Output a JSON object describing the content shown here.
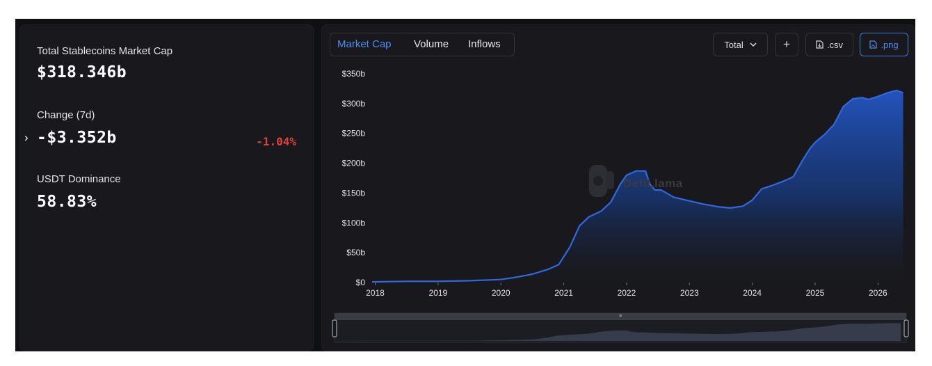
{
  "stats": {
    "market_cap_label": "Total Stablecoins Market Cap",
    "market_cap_value": "$318.346b",
    "change_label": "Change (7d)",
    "change_value": "-$3.352b",
    "change_pct": "-1.04%",
    "dominance_label": "USDT Dominance",
    "dominance_value": "58.83%"
  },
  "tabs": [
    "Market Cap",
    "Volume",
    "Inflows"
  ],
  "active_tab": "Market Cap",
  "controls": {
    "total_label": "Total",
    "plus_label": "+",
    "csv_label": ".csv",
    "png_label": ".png"
  },
  "watermark": "DefiLlama",
  "colors": {
    "line": "#3168e0",
    "area_top": "#1f4aa8",
    "negative": "#e0413c",
    "accent": "#4f8cf0"
  },
  "chart_data": {
    "type": "area",
    "title": "",
    "xlabel": "",
    "ylabel": "",
    "x_ticks": [
      "2018",
      "2019",
      "2020",
      "2021",
      "2022",
      "2023",
      "2024",
      "2025",
      "2026"
    ],
    "y_ticks": [
      "$0",
      "$50b",
      "$100b",
      "$150b",
      "$200b",
      "$250b",
      "$300b",
      "$350b"
    ],
    "ylim": [
      0,
      350
    ],
    "xlim": [
      2017.95,
      2026.45
    ],
    "unit": "billions USD",
    "grid": false,
    "series": [
      {
        "name": "",
        "x": [
          2017.95,
          2018.5,
          2019.0,
          2019.5,
          2020.0,
          2020.25,
          2020.5,
          2020.75,
          2020.92,
          2021.1,
          2021.25,
          2021.4,
          2021.6,
          2021.75,
          2021.9,
          2022.0,
          2022.15,
          2022.3,
          2022.37,
          2022.45,
          2022.55,
          2022.75,
          2022.95,
          2023.2,
          2023.45,
          2023.65,
          2023.85,
          2024.0,
          2024.15,
          2024.3,
          2024.5,
          2024.65,
          2024.8,
          2024.92,
          2025.0,
          2025.15,
          2025.3,
          2025.45,
          2025.6,
          2025.75,
          2025.85,
          2026.0,
          2026.15,
          2026.3,
          2026.4
        ],
        "values": [
          1,
          2,
          2,
          3,
          5,
          9,
          14,
          22,
          30,
          60,
          95,
          110,
          120,
          135,
          165,
          180,
          187,
          187,
          165,
          155,
          155,
          143,
          138,
          132,
          127,
          125,
          128,
          138,
          157,
          162,
          170,
          177,
          205,
          225,
          235,
          248,
          265,
          295,
          308,
          310,
          307,
          312,
          318,
          322,
          318
        ]
      }
    ]
  }
}
